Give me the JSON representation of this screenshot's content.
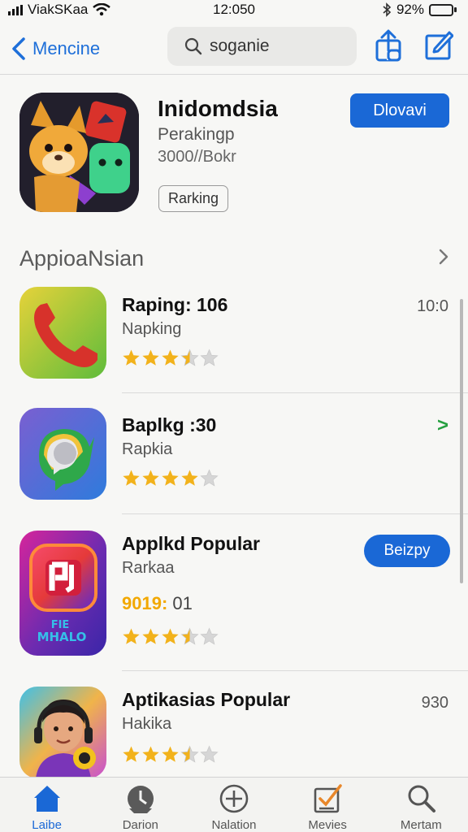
{
  "status_bar": {
    "carrier": "ViakSKaa",
    "time": "12:050",
    "battery": "92%",
    "battery_level": 0.92
  },
  "nav": {
    "back_label": "Mencine",
    "search_value": "soganie"
  },
  "hero": {
    "title": "Inidomdsia",
    "subtitle": "Perakingp",
    "meta": "3000//Bokr",
    "tag": "Rarking",
    "button_label": "Dlovavi"
  },
  "section": {
    "title": "AppioaNsian"
  },
  "apps": [
    {
      "name": "Raping: 106",
      "category": "Napking",
      "rating": 3.5,
      "trailing": "10:0"
    },
    {
      "name": "Baplkg :30",
      "category": "Rapkia",
      "rating": 4,
      "trailing": ">"
    },
    {
      "name": "Applkd Popular",
      "category": "Rarkaa",
      "extra_highlight": "9019:",
      "extra_rest": "01",
      "rating": 3.5,
      "button_label": "Beizpy"
    },
    {
      "name": "Aptikasias Popular",
      "category": "Hakika",
      "rating": 3.5,
      "trailing": "930"
    }
  ],
  "app_icon_texts": {
    "third_icon_line1": "FIE",
    "third_icon_line2": "MHALO"
  },
  "tabs": [
    {
      "label": "Laibe",
      "icon": "home-icon",
      "active": true
    },
    {
      "label": "Darion",
      "icon": "clock-icon",
      "active": false
    },
    {
      "label": "Nalation",
      "icon": "plus-circle-icon",
      "active": false
    },
    {
      "label": "Mevies",
      "icon": "checklist-icon",
      "active": false
    },
    {
      "label": "Mertam",
      "icon": "search-icon",
      "active": false
    }
  ],
  "colors": {
    "accent": "#1a68d6",
    "star": "#f2b21b",
    "star_empty": "#d6d6d6",
    "battery": "#2fbf3a"
  }
}
